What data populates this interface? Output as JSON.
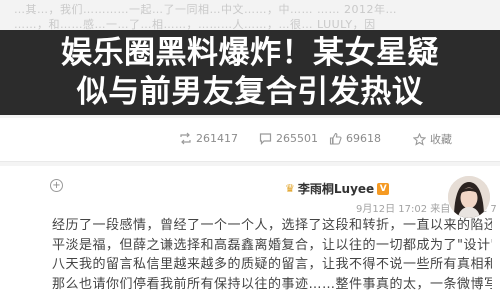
{
  "background_text": {
    "line1": "…其…，我们…………一起…了一同相…中文……，中…… …… 2012年…",
    "line2": "……，和……感…一…了…相……，………人……，…很… LUULY，因"
  },
  "headline": {
    "line1": "娱乐圈黑料爆炸！某女星疑",
    "line2": "似与前男友复合引发热议"
  },
  "actions": {
    "repost": "261417",
    "comment": "265501",
    "like": "69618",
    "favorite": "收藏"
  },
  "post": {
    "username": "李雨桐Luyee",
    "meta": "9月12日 17:02 来自 iPhone 7 Plus",
    "lines": [
      "经历了一段感情，曾经了一个一个人，选择了这段和转折，一直以来的陷还是努力自己",
      "平淡是福，但薛之谦选择和高磊鑫离婚复合，让以往的一切都成为了\"设计\"，以及近",
      "八天我的留言私信里越来越多的质疑的留言，让我不得不说一些所有真相和事实，",
      "那么也请你们停看我前所有保持以往的事迹……整件事真的太，一条微博写不完……"
    ]
  },
  "colors": {
    "overlay": "#1c1c1c",
    "badge": "#f59a23"
  }
}
